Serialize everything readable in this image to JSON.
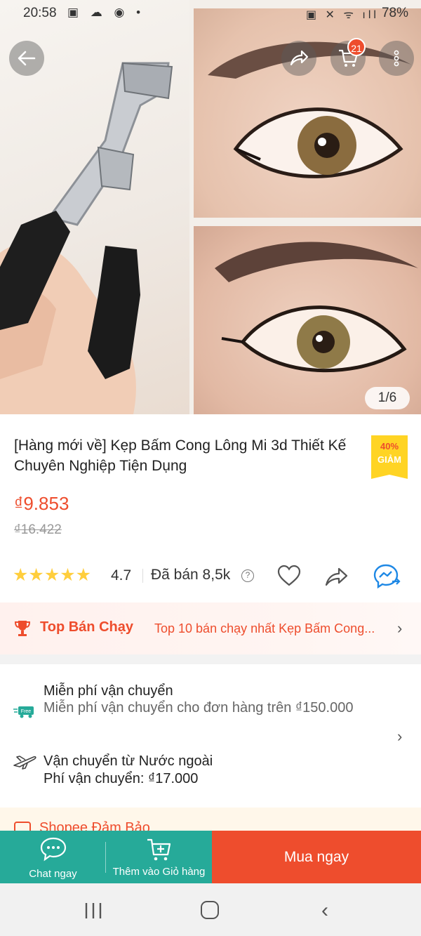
{
  "status_bar": {
    "time": "20:58",
    "left_icons": "▣ ☁ ◉ •",
    "right_icons": "▣ ✕ ᯤ ıll",
    "battery": "78%"
  },
  "gallery": {
    "counter": "1/6",
    "cart_badge": "21"
  },
  "product": {
    "title": "[Hàng mới về] Kẹp Bấm Cong Lông Mi 3d Thiết Kế Chuyên Nghiệp Tiện Dụng",
    "discount_percent": "40%",
    "discount_label": "GIẢM",
    "price": "₫9.853",
    "old_price": "₫16.422",
    "stars": "★★★★★",
    "rating": "4.7",
    "sold": "Đã bán 8,5k"
  },
  "top_selling": {
    "label": "Top Bán Chạy",
    "description": "Top 10 bán chạy nhất Kẹp Bấm Cong..."
  },
  "shipping": {
    "free_title": "Miễn phí vận chuyển",
    "free_sub": "Miễn phí vận chuyển cho đơn hàng trên ₫150.000",
    "abroad_title": "Vận chuyển từ Nước ngoài",
    "abroad_fee": "Phí vận chuyển: ₫17.000",
    "free_icon_text": "Free"
  },
  "guarantee": {
    "label": "Shopee Đảm Bảo"
  },
  "actions": {
    "chat": "Chat ngay",
    "add_to_cart": "Thêm vào Giỏ hàng",
    "buy_now": "Mua ngay"
  },
  "colors": {
    "accent": "#ee4d2d",
    "teal": "#26aa99",
    "star": "#ffce3d",
    "tag": "#ffd424"
  }
}
